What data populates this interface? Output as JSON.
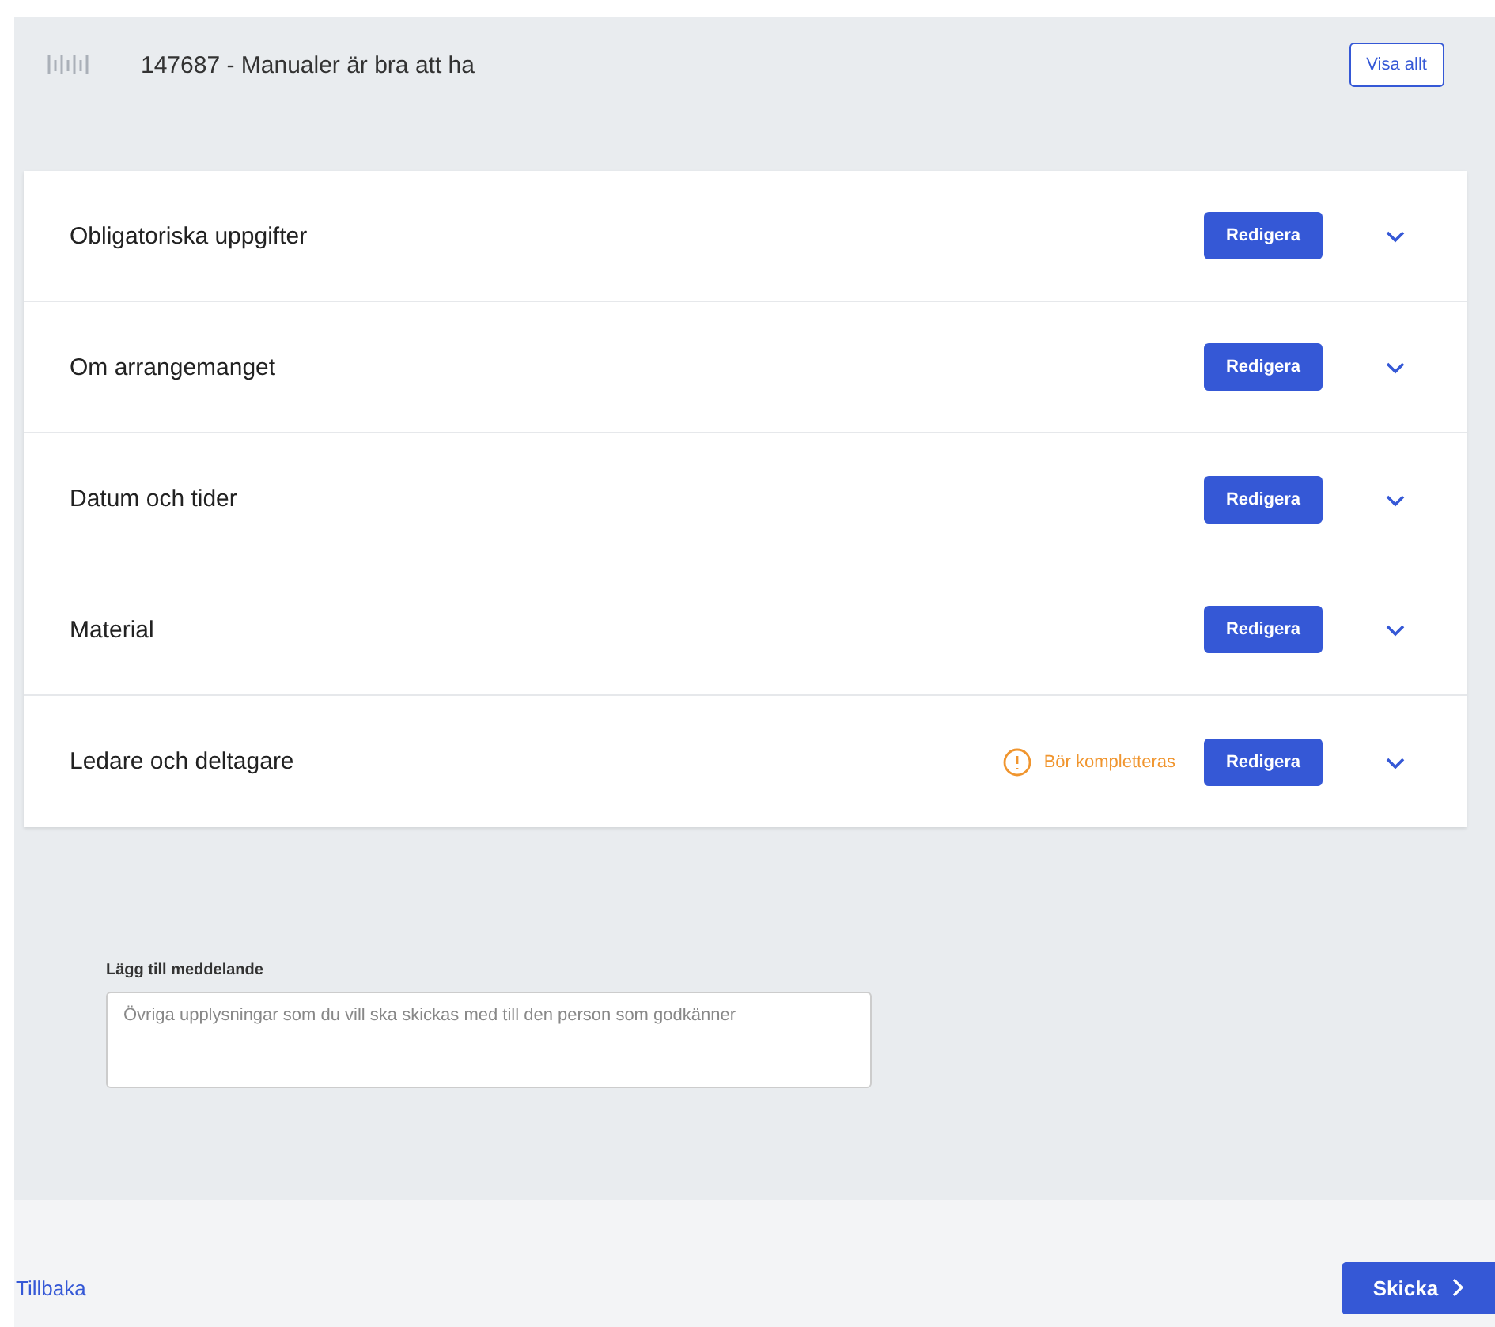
{
  "header": {
    "title": "147687 - Manualer är bra att ha",
    "button": "Visa allt"
  },
  "sections": [
    {
      "title": "Obligatoriska uppgifter",
      "button": "Redigera",
      "divider_below": true
    },
    {
      "title": "Om arrangemanget",
      "button": "Redigera",
      "divider_below": true
    },
    {
      "title": "Datum och tider",
      "button": "Redigera",
      "divider_below": false
    },
    {
      "title": "Material",
      "button": "Redigera",
      "divider_below": true
    },
    {
      "title": "Ledare och deltagare",
      "button": "Redigera",
      "warning": "Bör kompletteras",
      "divider_below": false
    }
  ],
  "message": {
    "label": "Lägg till meddelande",
    "placeholder": "Övriga upplysningar som du vill ska skickas med till den person som godkänner"
  },
  "footer": {
    "back": "Tillbaka",
    "submit": "Skicka"
  }
}
